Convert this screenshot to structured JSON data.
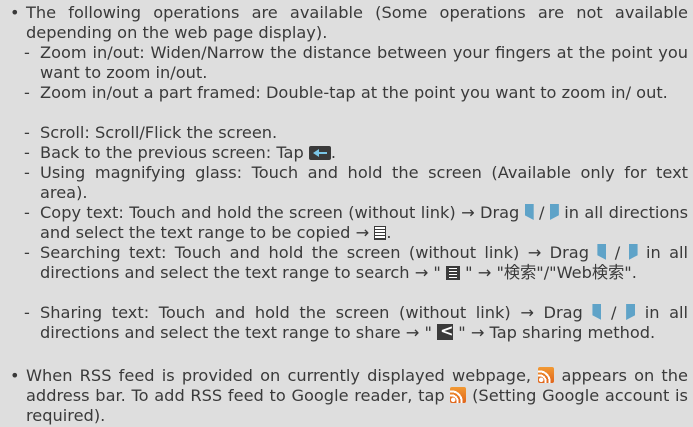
{
  "bullet_mark": "•",
  "dash_mark": "-",
  "intro": "The following operations are available (Some operations are not available depending on the web page display).",
  "ops": {
    "zoom": "Zoom in/out: Widen/Narrow the distance between your fingers at the point you want to zoom in/out.",
    "zoom_part": "Zoom in/out a part framed: Double-tap at the point you want to zoom in/ out.",
    "scroll": "Scroll: Scroll/Flick the screen.",
    "back_a": "Back to the previous screen: Tap ",
    "back_b": ".",
    "magnify": "Using magnifying glass: Touch and hold the screen (Available only for text area).",
    "copy_a": "Copy text: Touch and hold the screen (without link) → Drag ",
    "copy_b": " / ",
    "copy_c": " in all directions and select the text range to be copied → ",
    "copy_d": ".",
    "search_a": "Searching text: Touch and hold the screen (without link) → Drag ",
    "search_b": " / ",
    "search_c": " in all directions and select the text range to search → \" ",
    "search_d": " \" → \"検索\"/\"Web検索\".",
    "share_a": "Sharing text: Touch and hold the screen (without link) → Drag ",
    "share_b": " / ",
    "share_c": " in all directions and select the text range to share → \" ",
    "share_d": " \" → Tap sharing method."
  },
  "rss": {
    "a": "When RSS feed is provided on currently displayed webpage, ",
    "b": " appears on the address bar. To add RSS feed to Google reader, tap ",
    "c": " (Setting Google account is required)."
  },
  "icons": {
    "back": "back-icon",
    "handle_left": "selection-handle-left-icon",
    "handle_right": "selection-handle-right-icon",
    "copy": "copy-icon",
    "search": "search-text-icon",
    "share": "share-icon",
    "rss": "rss-icon"
  }
}
